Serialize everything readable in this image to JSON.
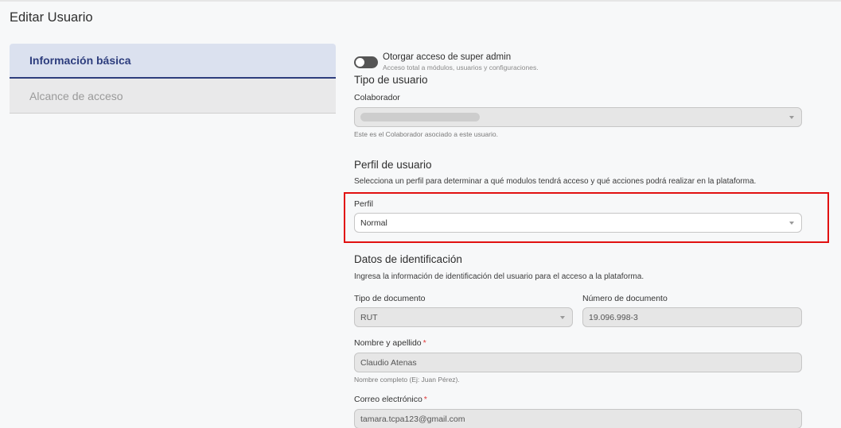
{
  "page": {
    "title": "Editar Usuario"
  },
  "nav": {
    "items": [
      {
        "label": "Información básica",
        "active": true
      },
      {
        "label": "Alcance de acceso",
        "active": false
      }
    ]
  },
  "super_admin": {
    "label": "Otorgar acceso de super admin",
    "help": "Acceso total a módulos, usuarios y configuraciones.",
    "enabled": false
  },
  "tipo_usuario": {
    "title": "Tipo de usuario",
    "colaborador_label": "Colaborador",
    "colaborador_help": "Este es el Colaborador asociado a este usuario."
  },
  "perfil_usuario": {
    "title": "Perfil de usuario",
    "description": "Selecciona un perfil para determinar a qué modulos tendrá acceso y qué acciones podrá realizar en la plataforma.",
    "perfil_label": "Perfil",
    "perfil_value": "Normal"
  },
  "identificacion": {
    "title": "Datos de identificación",
    "description": "Ingresa la información de identificación del usuario para el acceso a la plataforma.",
    "tipo_doc_label": "Tipo de documento",
    "tipo_doc_value": "RUT",
    "num_doc_label": "Número de documento",
    "num_doc_value": "19.096.998-3",
    "nombre_label": "Nombre y apellido",
    "nombre_value": "Claudio Atenas",
    "nombre_help": "Nombre completo (Ej: Juan Pérez).",
    "correo_label": "Correo electrónico",
    "correo_value": "tamara.tcpa123@gmail.com",
    "required_mark": "*"
  },
  "colors": {
    "accent": "#2d3d7d",
    "highlight": "#e11010",
    "required": "#e03a3a"
  }
}
